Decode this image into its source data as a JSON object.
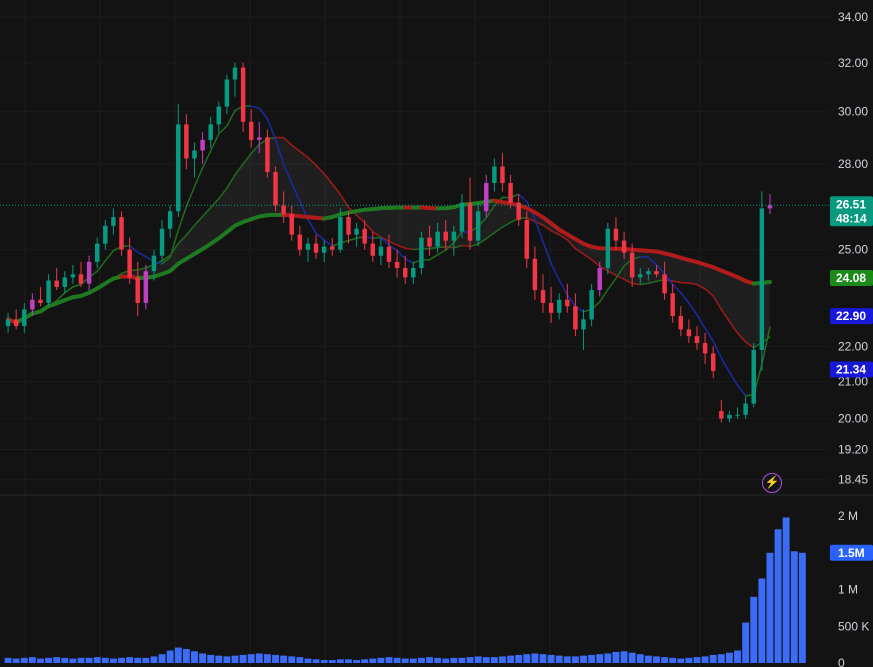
{
  "chart_data": {
    "type": "candlestick",
    "price_axis": {
      "ticks": [
        {
          "value": 34.0,
          "label": "34.00"
        },
        {
          "value": 32.0,
          "label": "32.00"
        },
        {
          "value": 30.0,
          "label": "30.00"
        },
        {
          "value": 28.0,
          "label": "28.00"
        },
        {
          "value": 25.0,
          "label": "25.00"
        },
        {
          "value": 22.0,
          "label": "22.00"
        },
        {
          "value": 21.0,
          "label": "21.00"
        },
        {
          "value": 20.0,
          "label": "20.00"
        },
        {
          "value": 19.2,
          "label": "19.20"
        },
        {
          "value": 18.45,
          "label": "18.45"
        }
      ],
      "scale": "log"
    },
    "volume_axis": {
      "ticks": [
        {
          "value": 2000000,
          "label": "2 M"
        },
        {
          "value": 1000000,
          "label": "1 M"
        },
        {
          "value": 500000,
          "label": "500 K"
        },
        {
          "value": 0,
          "label": "0"
        }
      ]
    },
    "price_badges": [
      {
        "name": "last",
        "value": 26.51,
        "label": "26.51",
        "sublabel": "48:14",
        "color": "#089981"
      },
      {
        "name": "ma-green",
        "value": 24.08,
        "label": "24.08",
        "color": "#1b8a1b"
      },
      {
        "name": "ma-blue-1",
        "value": 22.9,
        "label": "22.90",
        "color": "#1818d8"
      },
      {
        "name": "ma-blue-2",
        "value": 21.34,
        "label": "21.34",
        "color": "#1818d8"
      }
    ],
    "volume_badge": {
      "value": 1500000,
      "label": "1.5M",
      "color": "#2962ff"
    },
    "colors": {
      "up": "#089981",
      "down": "#f23645",
      "up_pink": "#c040c0",
      "volume": "#3b6cf6",
      "ma_long": "#b01c1c",
      "ma_long_up": "#1f7a1f",
      "ma_mid": "#a01a1a",
      "ma_short": "#1a2aa8"
    },
    "candles": [
      [
        22.6,
        23.0,
        22.4,
        22.8
      ],
      [
        22.8,
        23.1,
        22.5,
        22.6
      ],
      [
        22.6,
        23.3,
        22.4,
        23.1
      ],
      [
        23.1,
        23.6,
        22.9,
        23.4
      ],
      [
        23.4,
        23.8,
        23.2,
        23.3
      ],
      [
        23.3,
        24.2,
        23.2,
        24.0
      ],
      [
        24.0,
        24.4,
        23.7,
        23.8
      ],
      [
        23.8,
        24.3,
        23.6,
        24.1
      ],
      [
        24.1,
        24.5,
        23.9,
        24.2
      ],
      [
        24.2,
        24.6,
        23.8,
        23.9
      ],
      [
        23.9,
        24.8,
        23.7,
        24.6
      ],
      [
        24.6,
        25.4,
        24.4,
        25.2
      ],
      [
        25.2,
        26.0,
        25.0,
        25.8
      ],
      [
        25.8,
        26.4,
        25.5,
        26.1
      ],
      [
        26.1,
        26.3,
        24.8,
        25.0
      ],
      [
        25.0,
        25.4,
        23.9,
        24.1
      ],
      [
        24.1,
        24.6,
        22.9,
        23.3
      ],
      [
        23.3,
        24.5,
        23.1,
        24.3
      ],
      [
        24.3,
        25.0,
        24.0,
        24.8
      ],
      [
        24.8,
        26.0,
        24.6,
        25.7
      ],
      [
        25.7,
        26.5,
        25.4,
        26.3
      ],
      [
        26.3,
        30.3,
        26.1,
        29.5
      ],
      [
        29.5,
        29.9,
        27.8,
        28.2
      ],
      [
        28.2,
        28.8,
        27.5,
        28.5
      ],
      [
        28.5,
        29.2,
        28.0,
        28.9
      ],
      [
        28.9,
        29.8,
        28.6,
        29.5
      ],
      [
        29.5,
        30.4,
        29.2,
        30.2
      ],
      [
        30.2,
        31.5,
        29.9,
        31.3
      ],
      [
        31.3,
        32.0,
        30.6,
        31.8
      ],
      [
        31.8,
        32.0,
        29.2,
        29.6
      ],
      [
        29.6,
        30.1,
        28.6,
        28.9
      ],
      [
        28.9,
        29.6,
        28.4,
        29.0
      ],
      [
        29.0,
        29.3,
        27.5,
        27.7
      ],
      [
        27.7,
        27.9,
        26.3,
        26.5
      ],
      [
        26.5,
        27.0,
        25.9,
        26.2
      ],
      [
        26.2,
        26.5,
        25.3,
        25.5
      ],
      [
        25.5,
        25.8,
        24.8,
        25.0
      ],
      [
        25.0,
        25.4,
        24.6,
        25.2
      ],
      [
        25.2,
        25.5,
        24.7,
        24.9
      ],
      [
        24.9,
        25.3,
        24.6,
        25.1
      ],
      [
        25.1,
        25.4,
        24.8,
        25.0
      ],
      [
        25.0,
        26.4,
        24.9,
        26.1
      ],
      [
        26.1,
        26.3,
        25.2,
        25.5
      ],
      [
        25.5,
        25.9,
        25.1,
        25.7
      ],
      [
        25.7,
        26.0,
        25.0,
        25.2
      ],
      [
        25.2,
        25.6,
        24.6,
        24.8
      ],
      [
        24.8,
        25.4,
        24.5,
        25.1
      ],
      [
        25.1,
        25.5,
        24.4,
        24.6
      ],
      [
        24.6,
        25.0,
        24.1,
        24.4
      ],
      [
        24.4,
        24.8,
        23.9,
        24.1
      ],
      [
        24.1,
        24.6,
        23.9,
        24.4
      ],
      [
        24.4,
        25.6,
        24.2,
        25.4
      ],
      [
        25.4,
        25.8,
        24.8,
        25.1
      ],
      [
        25.1,
        25.9,
        24.9,
        25.6
      ],
      [
        25.6,
        26.0,
        25.0,
        25.3
      ],
      [
        25.3,
        25.8,
        24.8,
        25.6
      ],
      [
        25.6,
        26.9,
        25.4,
        26.6
      ],
      [
        26.6,
        27.5,
        25.0,
        25.3
      ],
      [
        25.3,
        26.6,
        25.1,
        26.3
      ],
      [
        26.3,
        27.6,
        26.1,
        27.3
      ],
      [
        27.3,
        28.2,
        27.0,
        27.9
      ],
      [
        27.9,
        28.4,
        27.0,
        27.3
      ],
      [
        27.3,
        27.6,
        26.4,
        26.6
      ],
      [
        26.6,
        26.9,
        25.8,
        26.0
      ],
      [
        26.0,
        26.3,
        24.4,
        24.7
      ],
      [
        24.7,
        25.1,
        23.4,
        23.7
      ],
      [
        23.7,
        24.2,
        23.0,
        23.3
      ],
      [
        23.3,
        23.8,
        22.7,
        23.0
      ],
      [
        23.0,
        23.6,
        22.8,
        23.4
      ],
      [
        23.4,
        23.9,
        23.0,
        23.2
      ],
      [
        23.2,
        23.6,
        22.3,
        22.5
      ],
      [
        22.5,
        23.1,
        21.9,
        22.8
      ],
      [
        22.8,
        23.9,
        22.6,
        23.7
      ],
      [
        23.7,
        24.6,
        23.5,
        24.4
      ],
      [
        24.4,
        25.9,
        24.2,
        25.7
      ],
      [
        25.7,
        26.1,
        25.0,
        25.3
      ],
      [
        25.3,
        25.6,
        24.7,
        24.9
      ],
      [
        24.9,
        25.2,
        23.8,
        24.1
      ],
      [
        24.1,
        24.4,
        23.9,
        24.2
      ],
      [
        24.2,
        24.4,
        24.0,
        24.3
      ],
      [
        24.3,
        24.5,
        24.1,
        24.2
      ],
      [
        24.2,
        24.6,
        23.4,
        23.6
      ],
      [
        23.6,
        23.9,
        22.7,
        22.9
      ],
      [
        22.9,
        23.2,
        22.3,
        22.5
      ],
      [
        22.5,
        22.8,
        22.1,
        22.3
      ],
      [
        22.3,
        22.6,
        21.9,
        22.1
      ],
      [
        22.1,
        22.4,
        21.5,
        21.8
      ],
      [
        21.8,
        22.0,
        21.1,
        21.3
      ],
      [
        20.2,
        20.5,
        19.9,
        20.0
      ],
      [
        20.0,
        20.2,
        19.9,
        20.1
      ],
      [
        20.1,
        20.3,
        20.0,
        20.1
      ],
      [
        20.1,
        20.6,
        20.0,
        20.4
      ],
      [
        20.4,
        22.1,
        20.3,
        21.9
      ],
      [
        21.9,
        27.0,
        21.3,
        26.4
      ],
      [
        26.4,
        26.9,
        26.2,
        26.51
      ]
    ],
    "volumes": [
      0.07,
      0.06,
      0.07,
      0.08,
      0.06,
      0.07,
      0.08,
      0.07,
      0.06,
      0.07,
      0.07,
      0.08,
      0.07,
      0.06,
      0.07,
      0.08,
      0.07,
      0.07,
      0.09,
      0.12,
      0.17,
      0.21,
      0.19,
      0.16,
      0.13,
      0.11,
      0.1,
      0.09,
      0.1,
      0.11,
      0.12,
      0.13,
      0.12,
      0.11,
      0.1,
      0.09,
      0.08,
      0.06,
      0.05,
      0.04,
      0.04,
      0.05,
      0.05,
      0.04,
      0.05,
      0.06,
      0.07,
      0.08,
      0.07,
      0.06,
      0.06,
      0.07,
      0.08,
      0.07,
      0.06,
      0.07,
      0.07,
      0.08,
      0.09,
      0.08,
      0.08,
      0.09,
      0.1,
      0.11,
      0.12,
      0.13,
      0.12,
      0.11,
      0.1,
      0.09,
      0.09,
      0.1,
      0.11,
      0.12,
      0.13,
      0.15,
      0.16,
      0.14,
      0.12,
      0.1,
      0.09,
      0.08,
      0.07,
      0.06,
      0.07,
      0.08,
      0.09,
      0.11,
      0.12,
      0.14,
      0.17,
      0.55,
      0.9,
      1.15,
      1.5,
      1.82,
      1.98,
      1.52,
      1.5
    ]
  }
}
